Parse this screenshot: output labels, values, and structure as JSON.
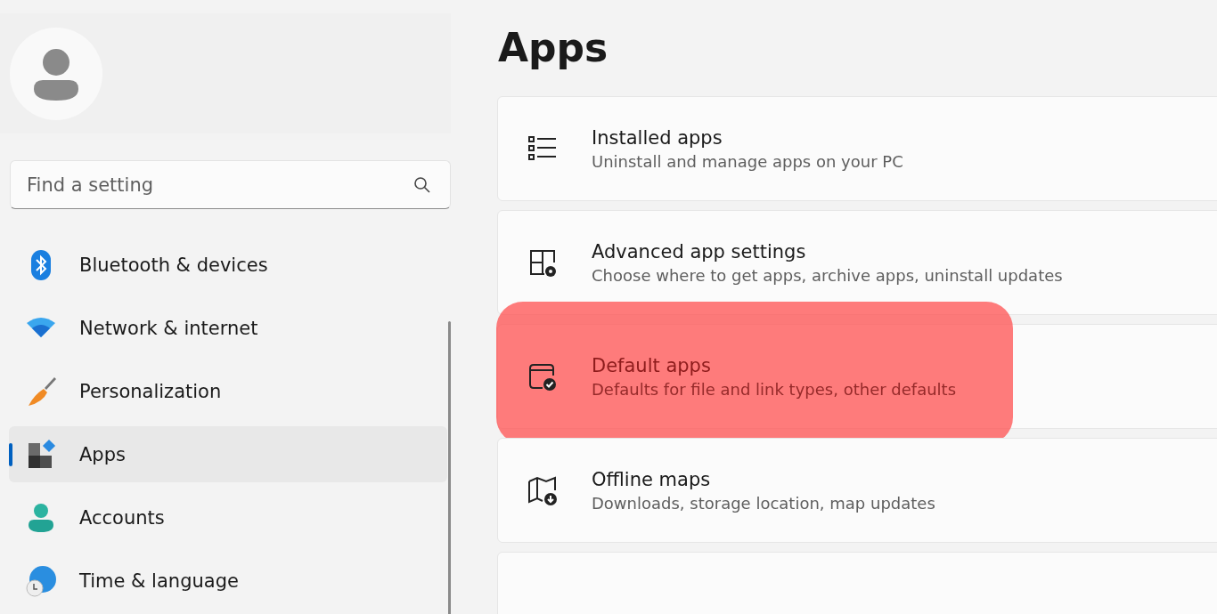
{
  "sidebar": {
    "search": {
      "placeholder": "Find a setting"
    },
    "items": [
      {
        "label": "Bluetooth & devices",
        "selected": false
      },
      {
        "label": "Network & internet",
        "selected": false
      },
      {
        "label": "Personalization",
        "selected": false
      },
      {
        "label": "Apps",
        "selected": true
      },
      {
        "label": "Accounts",
        "selected": false
      },
      {
        "label": "Time & language",
        "selected": false
      }
    ]
  },
  "page": {
    "title": "Apps",
    "cards": [
      {
        "title": "Installed apps",
        "subtitle": "Uninstall and manage apps on your PC",
        "highlighted": false
      },
      {
        "title": "Advanced app settings",
        "subtitle": "Choose where to get apps, archive apps, uninstall updates",
        "highlighted": false
      },
      {
        "title": "Default apps",
        "subtitle": "Defaults for file and link types, other defaults",
        "highlighted": true
      },
      {
        "title": "Offline maps",
        "subtitle": "Downloads, storage location, map updates",
        "highlighted": false
      },
      {
        "highlighted": false
      }
    ]
  }
}
